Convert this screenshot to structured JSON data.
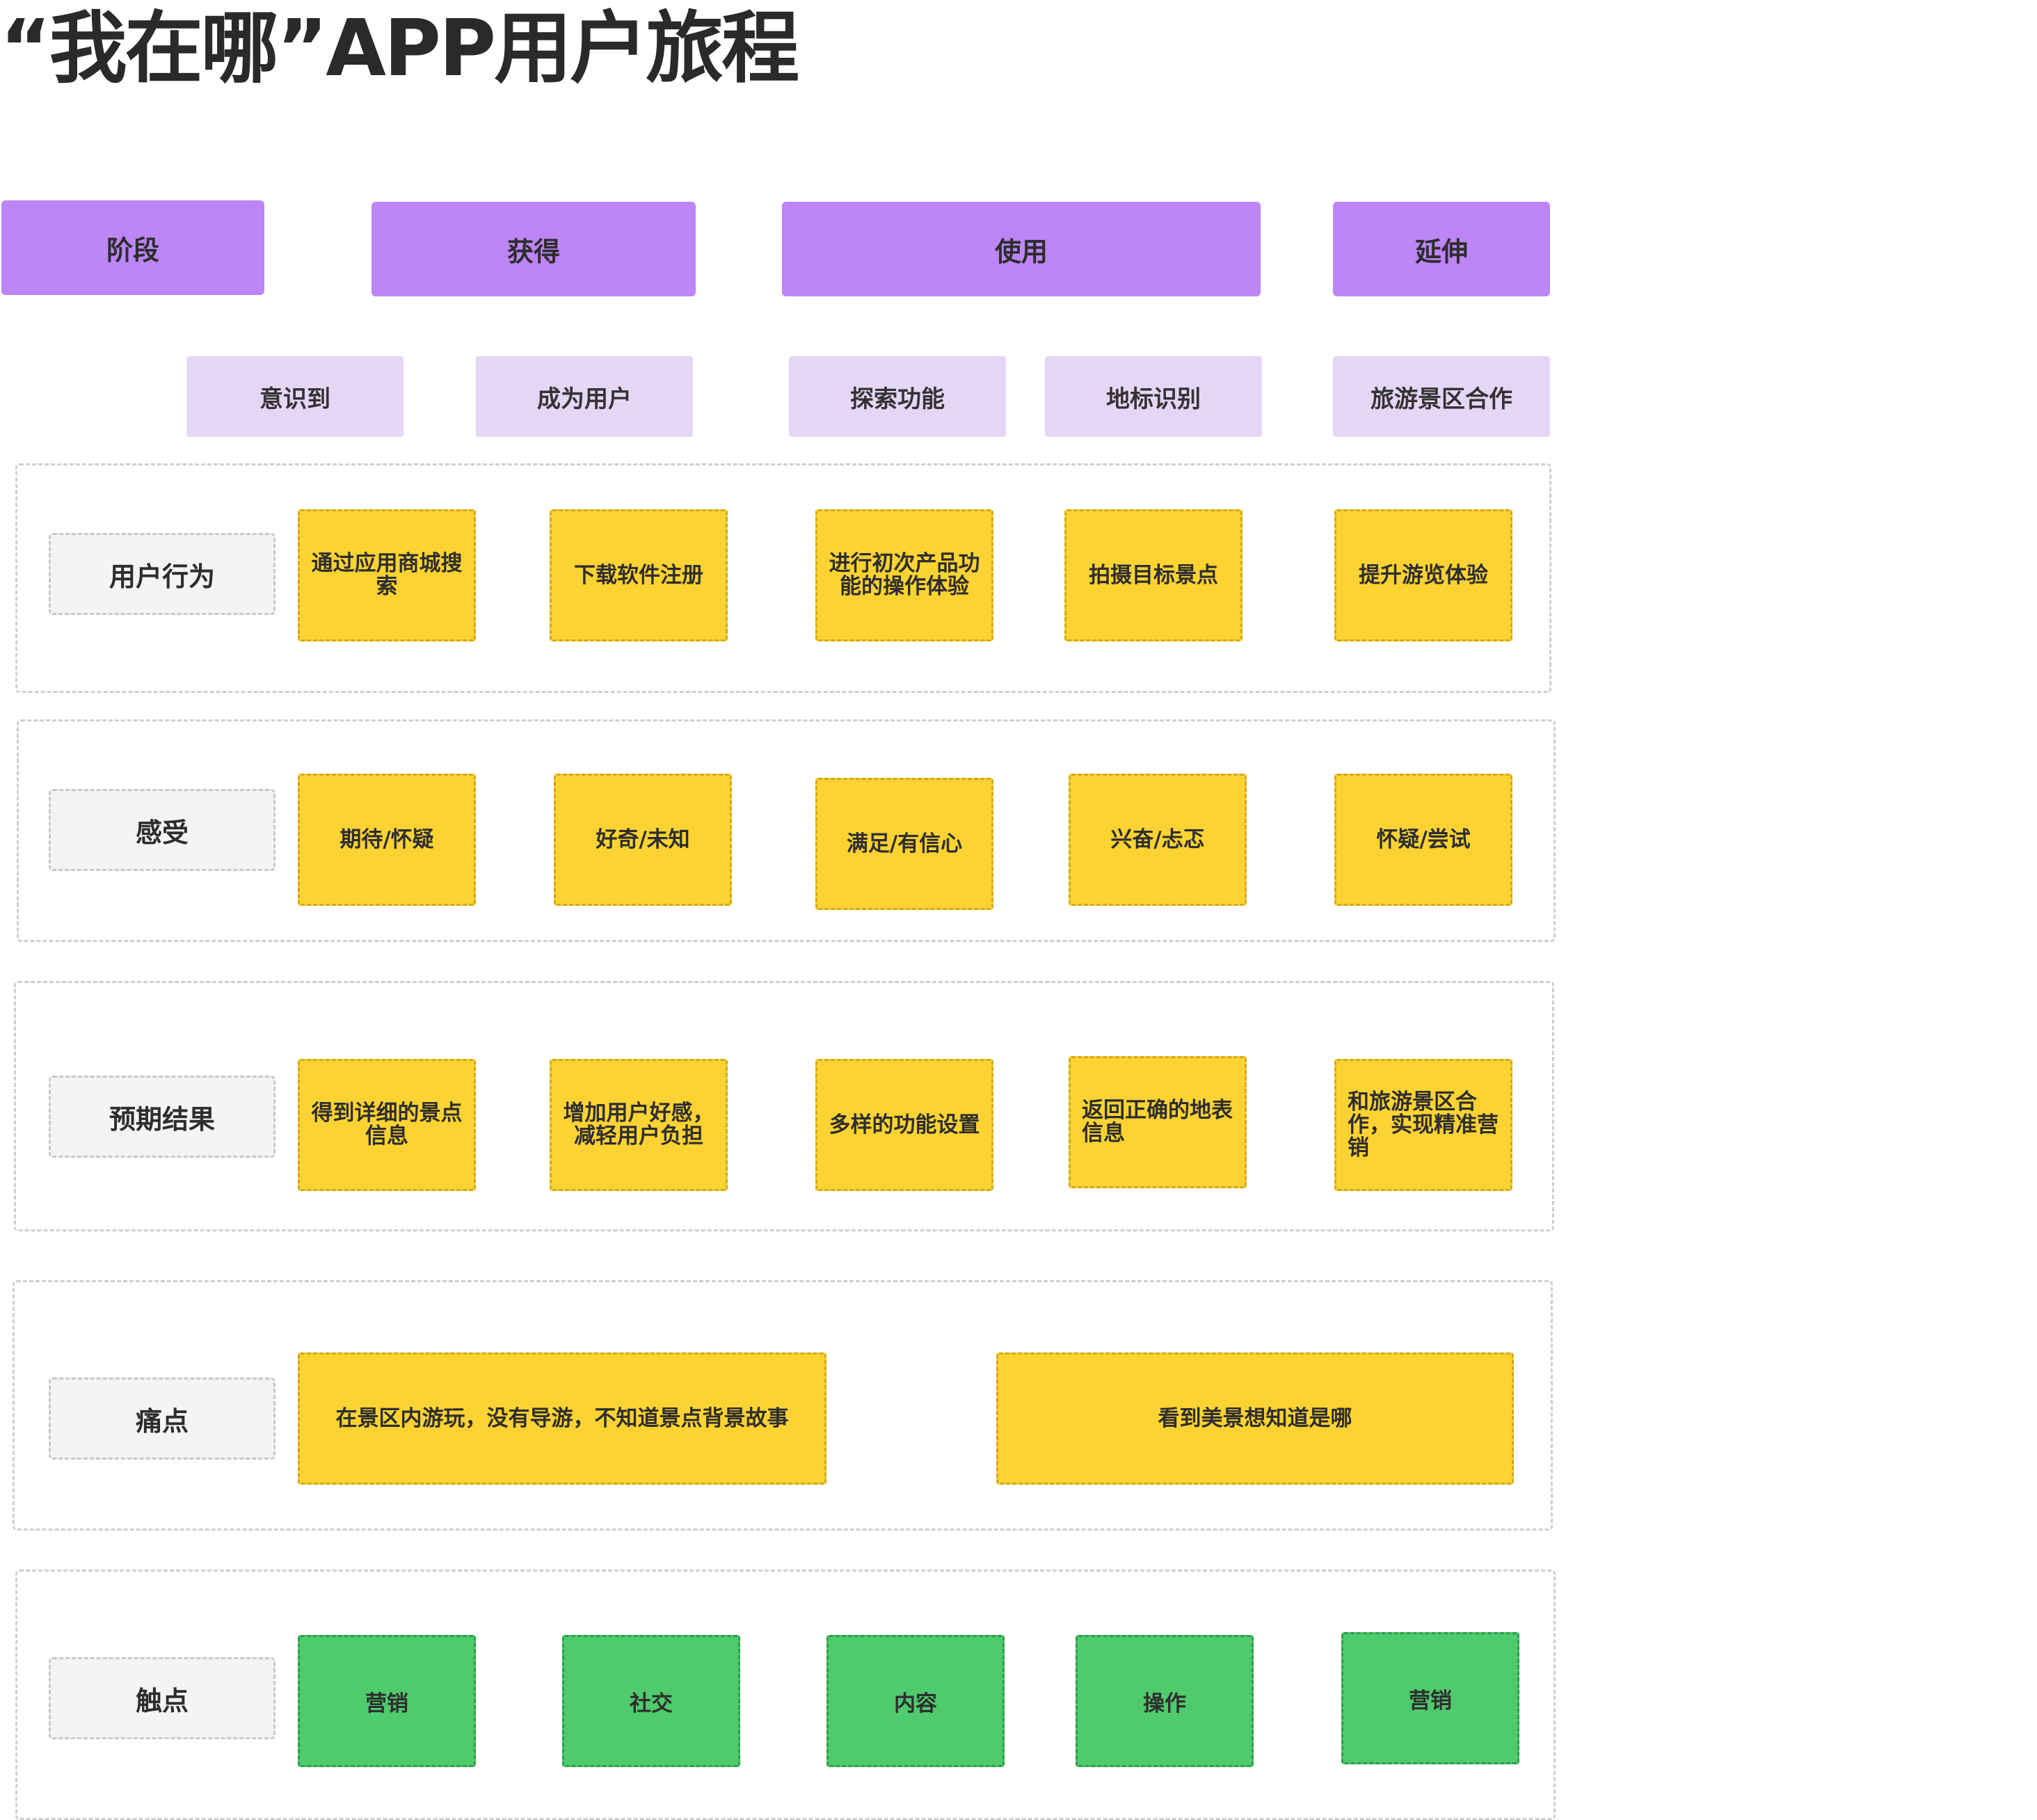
{
  "title": "“我在哪”APP用户旅程",
  "stages": [
    "阶段",
    "获得",
    "使用",
    "延伸"
  ],
  "substages": [
    "意识到",
    "成为用户",
    "探索功能",
    "地标识别",
    "旅游景区合作"
  ],
  "rows": {
    "behavior": {
      "label": "用户行为",
      "notes": [
        "通过应用商城搜索",
        "下载软件注册",
        "进行初次产品功能的操作体验",
        "拍摄目标景点",
        "提升游览体验"
      ]
    },
    "feeling": {
      "label": "感受",
      "notes": [
        "期待/怀疑",
        "好奇/未知",
        "满足/有信心",
        "兴奋/忐忑",
        "怀疑/尝试"
      ]
    },
    "expectation": {
      "label": "预期结果",
      "notes": [
        "得到详细的景点信息",
        "增加用户好感，减轻用户负担",
        "多样的功能设置",
        "返回正确的地表信息",
        "和旅游景区合作，实现精准营销"
      ]
    },
    "pain": {
      "label": "痛点",
      "notes": [
        "在景区内游玩，没有导游，不知道景点背景故事",
        "看到美景想知道是哪"
      ]
    },
    "touch": {
      "label": "触点",
      "notes": [
        "营销",
        "社交",
        "内容",
        "操作",
        "营销"
      ]
    }
  },
  "colors": {
    "stage": "#bd85f6",
    "substage": "#e5d6f6",
    "sticky_yellow": "#fdd333",
    "sticky_green": "#4fca6d",
    "row_label": "#f4f4f4"
  }
}
